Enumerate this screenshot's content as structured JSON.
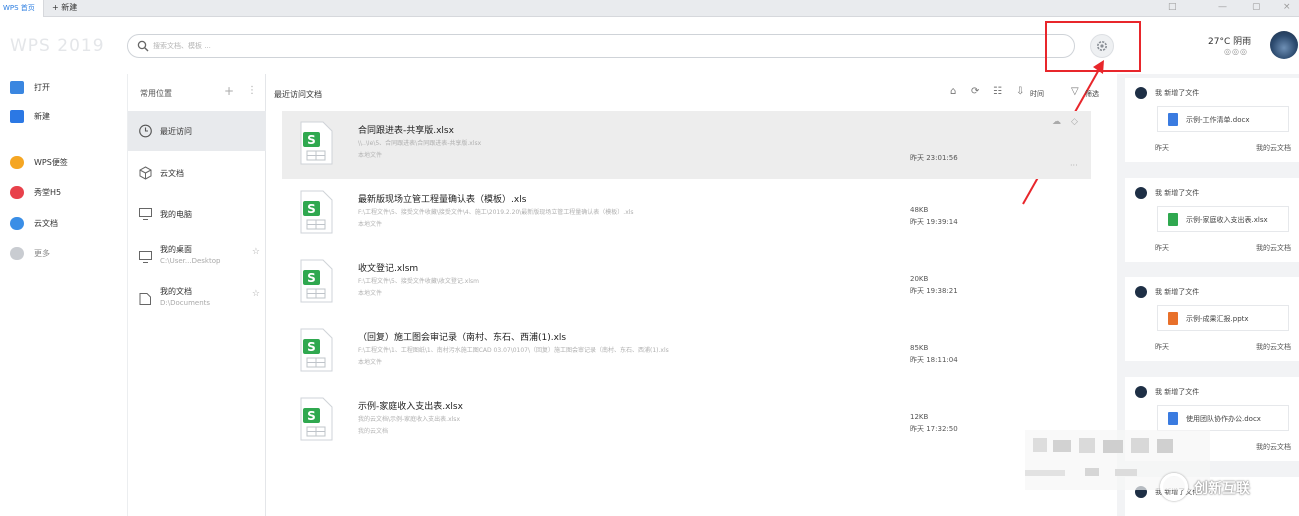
{
  "tabs": {
    "home_label": "WPS 首页",
    "new_label": "+ 新建"
  },
  "window_controls": [
    "□",
    "—",
    "▢",
    "×"
  ],
  "header": {
    "brand": "WPS 2019",
    "search_placeholder": "搜索文档、模板 ...",
    "weather": "27°C 阴雨",
    "weather_icons": "◎◎◎"
  },
  "left_nav": [
    {
      "label": "打开",
      "icon": "folder-icon",
      "color": "#3a86e0"
    },
    {
      "label": "新建",
      "icon": "new-file-icon",
      "color": "#2b78e4"
    },
    {
      "label": "WPS便签",
      "icon": "note-icon",
      "color": "#f5a623"
    },
    {
      "label": "秀堂H5",
      "icon": "h5-icon",
      "color": "#e8414b"
    },
    {
      "label": "云文档",
      "icon": "cloud-doc-icon",
      "color": "#3a8ee6"
    },
    {
      "label": "更多",
      "icon": "more-icon",
      "color": "#c9ccd1"
    }
  ],
  "locations": {
    "title": "常用位置",
    "add": "+",
    "more": "⋮",
    "items": [
      {
        "label": "最近访问",
        "sub": ""
      },
      {
        "label": "云文档",
        "sub": ""
      },
      {
        "label": "我的电脑",
        "sub": ""
      },
      {
        "label": "我的桌面",
        "sub": "C:\\User...Desktop"
      },
      {
        "label": "我的文档",
        "sub": "D:\\Documents"
      }
    ]
  },
  "list": {
    "title": "最近访问文档",
    "sort_label": "时间",
    "filter_label": "筛选",
    "toolbar_icons": [
      "home-icon",
      "refresh-icon",
      "list-view-icon",
      "sort-icon"
    ],
    "files": [
      {
        "name": "合同跟进表-共享版.xlsx",
        "path": "\\\\..\\Ie\\5、合同跟进表\\合同跟进表-共享版.xlsx",
        "location": "本地文件",
        "size": "",
        "time": "昨天 23:01:56"
      },
      {
        "name": "最新版现场立管工程量确认表（模板）.xls",
        "path": "F:\\工程文件\\5、接受文件收藏\\接受文件\\4、施工\\2019.2.20\\最新版现场立管工程量确认表（模板）.xls",
        "location": "本地文件",
        "size": "48KB",
        "time": "昨天 19:39:14"
      },
      {
        "name": "收文登记.xlsm",
        "path": "F:\\工程文件\\5、接受文件收藏\\收文登记.xlsm",
        "location": "本地文件",
        "size": "20KB",
        "time": "昨天 19:38:21"
      },
      {
        "name": "（回复）施工图会审记录（南村、东石、西浦(1).xls",
        "path": "F:\\工程文件\\1、工程图纸\\1、南村污水施工图CAD 03.07\\0107\\（回复）施工图会审记录（南村、东石、西浦(1).xls",
        "location": "本地文件",
        "size": "85KB",
        "time": "昨天 18:11:04"
      },
      {
        "name": "示例-家庭收入支出表.xlsx",
        "path": "我的云文档\\示例-家庭收入支出表.xlsx",
        "location": "我的云文档",
        "size": "12KB",
        "time": "昨天 17:32:50"
      }
    ]
  },
  "feed": [
    {
      "head": "我 新增了文件",
      "file": "示例-工作清单.docx",
      "type_color": "#3a7be0",
      "date": "昨天",
      "source": "我的云文档"
    },
    {
      "head": "我 新增了文件",
      "file": "示例-家庭收入支出表.xlsx",
      "type_color": "#2fa84f",
      "date": "昨天",
      "source": "我的云文档"
    },
    {
      "head": "我 新增了文件",
      "file": "示例-成果汇报.pptx",
      "type_color": "#e8702a",
      "date": "昨天",
      "source": "我的云文档"
    },
    {
      "head": "我 新增了文件",
      "file": "使用团队协作办公.docx",
      "type_color": "#3a7be0",
      "date": "",
      "source": "我的云文档"
    },
    {
      "head": "我 新增了文件",
      "file": "",
      "type_color": "#3a7be0",
      "date": "",
      "source": ""
    }
  ],
  "watermark": "创新互联",
  "colors": {
    "accent": "#2b7de0",
    "highlight": "#e8262b",
    "spreadsheet_green": "#2fa84f"
  }
}
